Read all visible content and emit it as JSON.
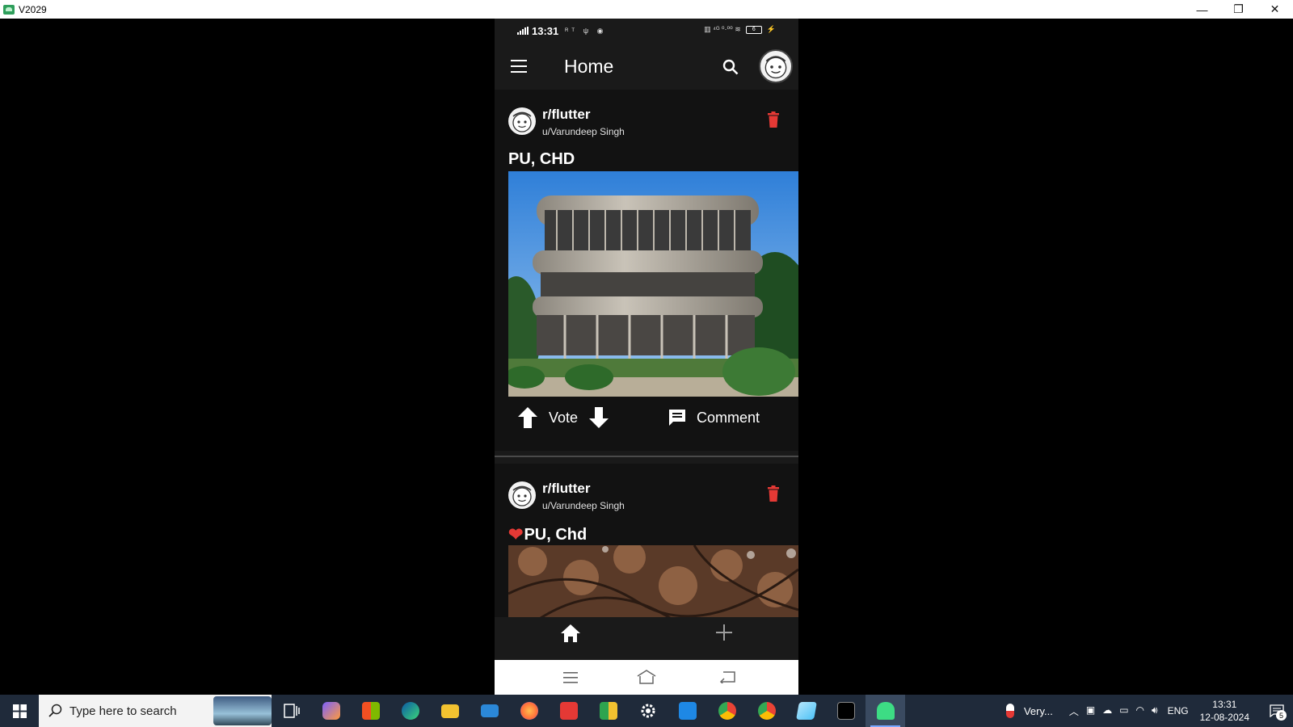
{
  "window": {
    "title": "V2029",
    "minimize_glyph": "—",
    "restore_glyph": "❐",
    "close_glyph": "✕"
  },
  "status_bar": {
    "time": "13:31",
    "left_icons": "ᴿᵀ ψ ◉",
    "right_icons": "▥ ⁴ᴳ ⁰·⁰⁰ ≋",
    "battery": "6"
  },
  "app_bar": {
    "title": "Home"
  },
  "posts": [
    {
      "subreddit": "r/flutter",
      "username": "u/Varundeep Singh",
      "title": "PU, CHD",
      "title_prefix": "",
      "vote_label": "Vote",
      "comment_label": "Comment"
    },
    {
      "subreddit": "r/flutter",
      "username": "u/Varundeep Singh",
      "title": "PU, Chd",
      "title_prefix": "❤"
    }
  ],
  "taskbar": {
    "search_placeholder": "Type here to search",
    "weather": "Very...",
    "language": "ENG",
    "clock_time": "13:31",
    "clock_date": "12-08-2024",
    "notification_count": "5",
    "apps": [
      {
        "name": "task-view-icon",
        "color": "#1f2a3a"
      },
      {
        "name": "copilot-icon",
        "color": "#7b61ff"
      },
      {
        "name": "microsoft-store-icon",
        "color": "#2b88d8"
      },
      {
        "name": "edge-icon",
        "color": "#1fa0a8"
      },
      {
        "name": "file-explorer-icon",
        "color": "#f2c230"
      },
      {
        "name": "mail-icon",
        "color": "#2b88d8"
      },
      {
        "name": "firefox-icon",
        "color": "#ff7139"
      },
      {
        "name": "wps-office-icon",
        "color": "#e53935"
      },
      {
        "name": "chat-app-icon",
        "color": "#2ea44f"
      },
      {
        "name": "settings-icon",
        "color": "#9aa3ad"
      },
      {
        "name": "vscode-icon",
        "color": "#1e88e5"
      },
      {
        "name": "chrome-icon",
        "color": "#ea4335"
      },
      {
        "name": "chrome-profile-icon",
        "color": "#34a853"
      },
      {
        "name": "notes-app-icon",
        "color": "#4fc3f7"
      },
      {
        "name": "terminal-icon",
        "color": "#000000"
      },
      {
        "name": "android-emulator-icon",
        "color": "#3ddc84"
      }
    ]
  },
  "colors": {
    "accent_delete": "#e53935",
    "background": "#000000",
    "post_bg": "#121212",
    "text": "#ffffff"
  }
}
